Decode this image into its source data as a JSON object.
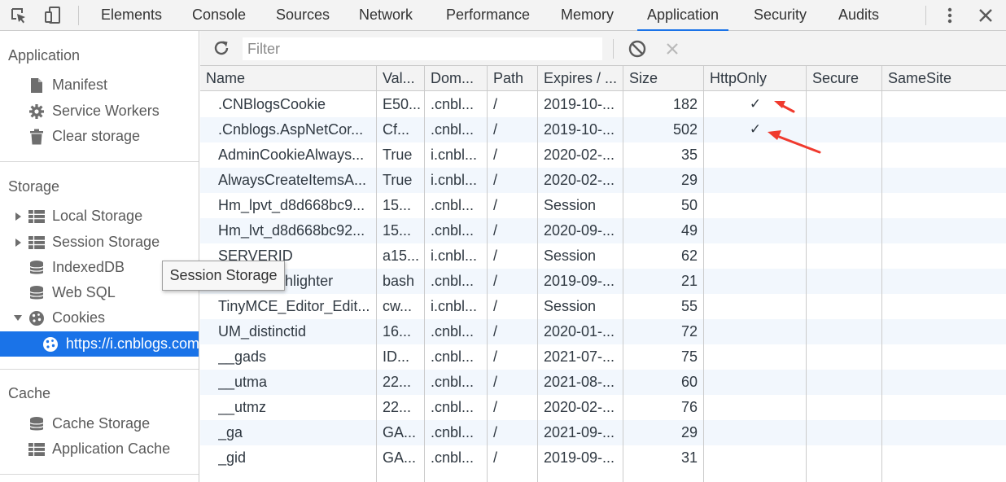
{
  "toolbar": {
    "tabs": [
      {
        "label": "Elements"
      },
      {
        "label": "Console"
      },
      {
        "label": "Sources"
      },
      {
        "label": "Network"
      },
      {
        "label": "Performance"
      },
      {
        "label": "Memory"
      },
      {
        "label": "Application",
        "active": true
      },
      {
        "label": "Security"
      },
      {
        "label": "Audits"
      }
    ],
    "icons": [
      "inspect-icon",
      "device-toolbar-icon",
      "more-menu-icon",
      "close-icon"
    ]
  },
  "sidebar": {
    "sections": {
      "application": "Application",
      "storage": "Storage",
      "cache": "Cache"
    },
    "application_items": [
      "Manifest",
      "Service Workers",
      "Clear storage"
    ],
    "storage_items": [
      "Local Storage",
      "Session Storage",
      "IndexedDB",
      "Web SQL",
      "Cookies"
    ],
    "cookie_origin": "https://i.cnblogs.com",
    "cache_items": [
      "Cache Storage",
      "Application Cache"
    ]
  },
  "filter": {
    "placeholder": "Filter"
  },
  "table": {
    "headers": [
      "Name",
      "Val...",
      "Dom...",
      "Path",
      "Expires / ...",
      "Size",
      "HttpOnly",
      "Secure",
      "SameSite"
    ],
    "rows": [
      {
        "name": ".CNBlogsCookie",
        "value": "E50...",
        "domain": ".cnbl...",
        "path": "/",
        "expires": "2019-10-...",
        "size": "182",
        "httponly": "✓",
        "secure": "",
        "samesite": ""
      },
      {
        "name": ".Cnblogs.AspNetCor...",
        "value": "Cf...",
        "domain": ".cnbl...",
        "path": "/",
        "expires": "2019-10-...",
        "size": "502",
        "httponly": "✓",
        "secure": "",
        "samesite": ""
      },
      {
        "name": "AdminCookieAlways...",
        "value": "True",
        "domain": "i.cnbl...",
        "path": "/",
        "expires": "2020-02-...",
        "size": "35",
        "httponly": "",
        "secure": "",
        "samesite": ""
      },
      {
        "name": "AlwaysCreateItemsA...",
        "value": "True",
        "domain": "i.cnbl...",
        "path": "/",
        "expires": "2020-02-...",
        "size": "29",
        "httponly": "",
        "secure": "",
        "samesite": ""
      },
      {
        "name": "Hm_lpvt_d8d668bc9...",
        "value": "15...",
        "domain": ".cnbl...",
        "path": "/",
        "expires": "Session",
        "size": "50",
        "httponly": "",
        "secure": "",
        "samesite": ""
      },
      {
        "name": "Hm_lvt_d8d668bc92...",
        "value": "15...",
        "domain": ".cnbl...",
        "path": "/",
        "expires": "2020-09-...",
        "size": "49",
        "httponly": "",
        "secure": "",
        "samesite": ""
      },
      {
        "name": "SERVERID",
        "value": "a15...",
        "domain": "i.cnbl...",
        "path": "/",
        "expires": "Session",
        "size": "62",
        "httponly": "",
        "secure": "",
        "samesite": ""
      },
      {
        "name": "SyntaxHighlighter",
        "value": "bash",
        "domain": ".cnbl...",
        "path": "/",
        "expires": "2019-09-...",
        "size": "21",
        "httponly": "",
        "secure": "",
        "samesite": ""
      },
      {
        "name": "TinyMCE_Editor_Edit...",
        "value": "cw...",
        "domain": "i.cnbl...",
        "path": "/",
        "expires": "Session",
        "size": "55",
        "httponly": "",
        "secure": "",
        "samesite": ""
      },
      {
        "name": "UM_distinctid",
        "value": "16...",
        "domain": ".cnbl...",
        "path": "/",
        "expires": "2020-01-...",
        "size": "72",
        "httponly": "",
        "secure": "",
        "samesite": ""
      },
      {
        "name": "__gads",
        "value": "ID...",
        "domain": ".cnbl...",
        "path": "/",
        "expires": "2021-07-...",
        "size": "75",
        "httponly": "",
        "secure": "",
        "samesite": ""
      },
      {
        "name": "__utma",
        "value": "22...",
        "domain": ".cnbl...",
        "path": "/",
        "expires": "2021-08-...",
        "size": "60",
        "httponly": "",
        "secure": "",
        "samesite": ""
      },
      {
        "name": "__utmz",
        "value": "22...",
        "domain": ".cnbl...",
        "path": "/",
        "expires": "2020-02-...",
        "size": "76",
        "httponly": "",
        "secure": "",
        "samesite": ""
      },
      {
        "name": "_ga",
        "value": "GA...",
        "domain": ".cnbl...",
        "path": "/",
        "expires": "2021-09-...",
        "size": "29",
        "httponly": "",
        "secure": "",
        "samesite": ""
      },
      {
        "name": "_gid",
        "value": "GA...",
        "domain": ".cnbl...",
        "path": "/",
        "expires": "2019-09-...",
        "size": "31",
        "httponly": "",
        "secure": "",
        "samesite": ""
      }
    ]
  },
  "tooltip": {
    "text": "Session Storage"
  },
  "colors": {
    "accent": "#1a73e8",
    "annotation_arrow": "#f03a2e",
    "row_alt": "#f2f7fd"
  }
}
